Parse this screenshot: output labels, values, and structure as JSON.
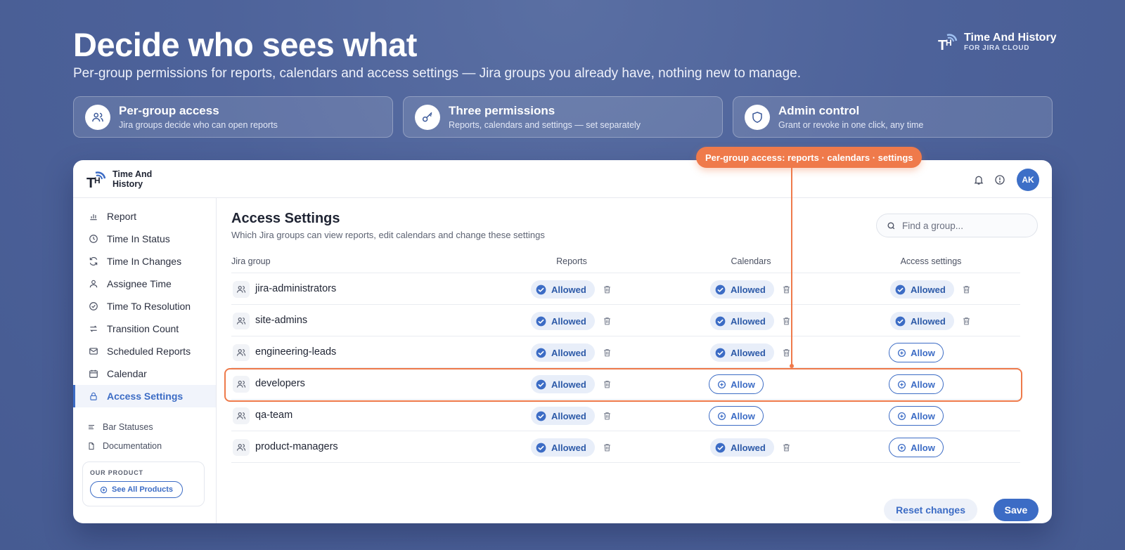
{
  "hero": {
    "title": "Decide who sees what",
    "subtitle": "Per-group permissions for reports, calendars and access settings — Jira groups you already have, nothing new to manage."
  },
  "brand": {
    "name": "Time And History",
    "tagline": "FOR JIRA CLOUD"
  },
  "features": [
    {
      "icon": "users-icon",
      "title": "Per-group access",
      "desc": "Jira groups decide who can open reports"
    },
    {
      "icon": "key-icon",
      "title": "Three permissions",
      "desc": "Reports, calendars and settings — set separately"
    },
    {
      "icon": "shield-icon",
      "title": "Admin control",
      "desc": "Grant or revoke in one click, any time"
    }
  ],
  "app": {
    "brand_line1": "Time And",
    "brand_line2": "History",
    "avatar": "AK",
    "callout": "Per-group access: reports · calendars · settings"
  },
  "sidebar": {
    "items": [
      {
        "label": "Report",
        "icon": "bar-chart-icon"
      },
      {
        "label": "Time In Status",
        "icon": "clock-icon"
      },
      {
        "label": "Time In Changes",
        "icon": "refresh-icon"
      },
      {
        "label": "Assignee Time",
        "icon": "user-icon"
      },
      {
        "label": "Time To Resolution",
        "icon": "check-circle-icon"
      },
      {
        "label": "Transition Count",
        "icon": "arrows-icon"
      },
      {
        "label": "Scheduled Reports",
        "icon": "mail-icon"
      },
      {
        "label": "Calendar",
        "icon": "calendar-icon"
      },
      {
        "label": "Access Settings",
        "icon": "lock-icon",
        "active": true
      }
    ],
    "secondary": [
      {
        "label": "Bar Statuses",
        "icon": "lines-icon"
      },
      {
        "label": "Documentation",
        "icon": "document-icon"
      }
    ],
    "product_label": "OUR PRODUCT",
    "product_button": "See All Products"
  },
  "main": {
    "title": "Access Settings",
    "subtitle": "Which Jira groups can view reports, edit calendars and change these settings",
    "search_placeholder": "Find a group...",
    "columns": [
      "Jira group",
      "Reports",
      "Calendars",
      "Access settings"
    ],
    "rows": [
      {
        "name": "jira-administrators",
        "reports": "Allowed",
        "calendars": "Allowed",
        "access": "Allowed"
      },
      {
        "name": "site-admins",
        "reports": "Allowed",
        "calendars": "Allowed",
        "access": "Allowed"
      },
      {
        "name": "engineering-leads",
        "reports": "Allowed",
        "calendars": "Allowed",
        "access": "Allow"
      },
      {
        "name": "developers",
        "reports": "Allowed",
        "calendars": "Allow",
        "access": "Allow",
        "highlighted": true
      },
      {
        "name": "qa-team",
        "reports": "Allowed",
        "calendars": "Allow",
        "access": "Allow"
      },
      {
        "name": "product-managers",
        "reports": "Allowed",
        "calendars": "Allowed",
        "access": "Allow"
      }
    ],
    "reset_label": "Reset changes",
    "save_label": "Save"
  },
  "colors": {
    "accent": "#3c6cc5",
    "callout": "#ef7a4b",
    "background": "#4d629a"
  }
}
